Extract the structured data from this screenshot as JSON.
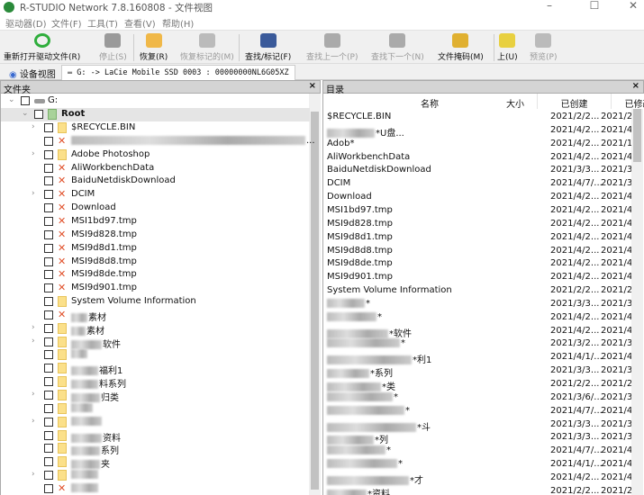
{
  "window": {
    "title": "R-STUDIO Network 7.8.160808 - 文件视图",
    "min": "–",
    "max": "☐",
    "close": "✕"
  },
  "menu": [
    "驱动器(D)",
    "文件(F)",
    "工具(T)",
    "查看(V)",
    "帮助(H)"
  ],
  "toolbar": [
    {
      "label": "重新打开驱动文件(R)",
      "icon": "refresh-icon",
      "color": "#2fae3c",
      "enabled": true
    },
    {
      "label": "停止(S)",
      "icon": "stop-icon",
      "color": "#9a9a9a",
      "enabled": false
    },
    {
      "label": "恢复(R)",
      "icon": "recover-icon",
      "color": "#f0b848",
      "enabled": true
    },
    {
      "label": "恢复标记的(M)",
      "icon": "recover-marked-icon",
      "color": "#bbbbbb",
      "enabled": false
    },
    {
      "label": "查找/标记(F)",
      "icon": "binoculars-icon",
      "color": "#3a5a9a",
      "enabled": true
    },
    {
      "label": "查找上一个(P)",
      "icon": "find-prev-icon",
      "color": "#aaaaaa",
      "enabled": false
    },
    {
      "label": "查找下一个(N)",
      "icon": "find-next-icon",
      "color": "#aaaaaa",
      "enabled": false
    },
    {
      "label": "文件掩码(M)",
      "icon": "file-mask-icon",
      "color": "#e0b030",
      "enabled": true
    },
    {
      "label": "上(U)",
      "icon": "folder-up-icon",
      "color": "#e8d040",
      "enabled": true
    },
    {
      "label": "预览(P)",
      "icon": "preview-icon",
      "color": "#bbbbbb",
      "enabled": false
    }
  ],
  "tabs": {
    "device": "设备视图",
    "drive": "G: -> LaCie Mobile SSD 0003 : 00000000NL6G05XZ"
  },
  "left": {
    "title": "文件夹",
    "close": "×",
    "drive": "G:",
    "root": "Root",
    "items": [
      {
        "name": "$RECYCLE.BIN",
        "type": "folder",
        "exp": true
      },
      {
        "name": "",
        "blur": true,
        "suffix": "...",
        "type": "del",
        "w": 260
      },
      {
        "name": "Adobe Photoshop",
        "type": "folder",
        "exp": true
      },
      {
        "name": "AliWorkbenchData",
        "type": "del"
      },
      {
        "name": "BaiduNetdiskDownload",
        "type": "del"
      },
      {
        "name": "DCIM",
        "type": "del",
        "exp": true
      },
      {
        "name": "Download",
        "type": "del"
      },
      {
        "name": "MSI1bd97.tmp",
        "type": "del"
      },
      {
        "name": "MSI9d828.tmp",
        "type": "del"
      },
      {
        "name": "MSI9d8d1.tmp",
        "type": "del"
      },
      {
        "name": "MSI9d8d8.tmp",
        "type": "del"
      },
      {
        "name": "MSI9d8de.tmp",
        "type": "del"
      },
      {
        "name": "MSI9d901.tmp",
        "type": "del"
      },
      {
        "name": "System Volume Information",
        "type": "folder"
      },
      {
        "name": "",
        "blur": true,
        "suffix": "素材",
        "type": "del",
        "w": 18
      },
      {
        "name": "",
        "blur": true,
        "suffix": "素材",
        "type": "folder",
        "exp": true,
        "w": 16
      },
      {
        "name": "",
        "blur": true,
        "suffix": "软件",
        "type": "folder",
        "exp": true,
        "w": 34
      },
      {
        "name": "",
        "blur": true,
        "suffix": "",
        "type": "folder",
        "w": 18
      },
      {
        "name": "",
        "blur": true,
        "suffix": "福利1",
        "type": "folder",
        "w": 30
      },
      {
        "name": "",
        "blur": true,
        "suffix": "料系列",
        "type": "folder",
        "w": 30
      },
      {
        "name": "",
        "blur": true,
        "suffix": "归类",
        "type": "folder",
        "exp": true,
        "w": 32
      },
      {
        "name": "",
        "blur": true,
        "suffix": "",
        "type": "folder",
        "w": 24
      },
      {
        "name": "",
        "blur": true,
        "suffix": "",
        "type": "folder",
        "exp": true,
        "w": 34
      },
      {
        "name": "",
        "blur": true,
        "suffix": "资料",
        "type": "folder",
        "w": 34
      },
      {
        "name": "",
        "blur": true,
        "suffix": "系列",
        "type": "folder",
        "w": 32
      },
      {
        "name": "",
        "blur": true,
        "suffix": "夹",
        "type": "folder",
        "w": 32
      },
      {
        "name": "",
        "blur": true,
        "suffix": "",
        "type": "folder",
        "exp": true,
        "w": 30
      },
      {
        "name": "",
        "blur": true,
        "suffix": "",
        "type": "del",
        "w": 30
      }
    ]
  },
  "right": {
    "title": "目录",
    "close": "×",
    "columns": [
      "名称",
      "大小",
      "已创建",
      "已修改"
    ],
    "rows": [
      [
        "$RECYCLE.BIN",
        "",
        "2021/2/2...",
        "2021/2/"
      ],
      [
        "*U盘...",
        "",
        "2021/4/2...",
        "2021/4/"
      ],
      [
        "Adob*",
        "",
        "2021/4/2...",
        "2021/1/"
      ],
      [
        "AliWorkbenchData",
        "",
        "2021/4/2...",
        "2021/4/"
      ],
      [
        "BaiduNetdiskDownload",
        "",
        "2021/3/3...",
        "2021/3/"
      ],
      [
        "DCIM",
        "",
        "2021/4/7/...",
        "2021/3/"
      ],
      [
        "Download",
        "",
        "2021/4/2...",
        "2021/4/"
      ],
      [
        "MSI1bd97.tmp",
        "",
        "2021/4/2...",
        "2021/4/"
      ],
      [
        "MSI9d828.tmp",
        "",
        "2021/4/2...",
        "2021/4/"
      ],
      [
        "MSI9d8d1.tmp",
        "",
        "2021/4/2...",
        "2021/4/"
      ],
      [
        "MSI9d8d8.tmp",
        "",
        "2021/4/2...",
        "2021/4/"
      ],
      [
        "MSI9d8de.tmp",
        "",
        "2021/4/2...",
        "2021/4/"
      ],
      [
        "MSI9d901.tmp",
        "",
        "2021/4/2...",
        "2021/4/"
      ],
      [
        "System Volume Information",
        "",
        "2021/2/2...",
        "2021/2/"
      ],
      [
        "*",
        "",
        "2021/3/3...",
        "2021/3/"
      ],
      [
        "*",
        "",
        "2021/4/2...",
        "2021/4/"
      ],
      [
        "*软件",
        "",
        "2021/4/2...",
        "2021/4/"
      ],
      [
        "*",
        "",
        "2021/3/2...",
        "2021/3/"
      ],
      [
        "*利1",
        "",
        "2021/4/1/...",
        "2021/4/"
      ],
      [
        "*系列",
        "",
        "2021/3/3...",
        "2021/3/"
      ],
      [
        "*类",
        "",
        "2021/2/2...",
        "2021/2/"
      ],
      [
        "*",
        "",
        "2021/3/6/...",
        "2021/3/"
      ],
      [
        "*",
        "",
        "2021/4/7/...",
        "2021/4/"
      ],
      [
        "*斗",
        "",
        "2021/3/3...",
        "2021/3/"
      ],
      [
        "*列",
        "",
        "2021/3/3...",
        "2021/3/"
      ],
      [
        "*",
        "",
        "2021/4/7/...",
        "2021/4/"
      ],
      [
        "*",
        "",
        "2021/4/1/...",
        "2021/4/"
      ],
      [
        "*才",
        "",
        "2021/4/2...",
        "2021/4/"
      ],
      [
        "*资料",
        "",
        "2021/2/2...",
        "2021/2/"
      ]
    ]
  }
}
